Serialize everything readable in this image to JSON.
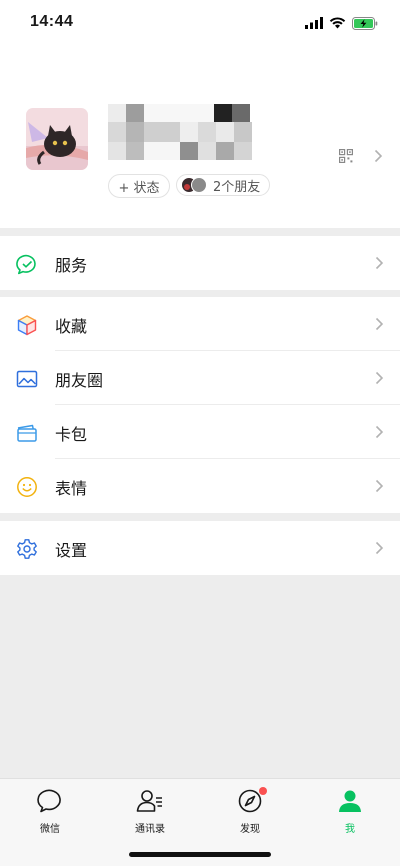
{
  "status_bar": {
    "time": "14:44"
  },
  "profile": {
    "status_chip": "+ 状态",
    "friends_chip": "2个朋友"
  },
  "menu": {
    "services": "服务",
    "favorites": "收藏",
    "moments": "朋友圈",
    "cards": "卡包",
    "stickers": "表情",
    "settings": "设置"
  },
  "tabs": [
    {
      "label": "微信"
    },
    {
      "label": "通讯录"
    },
    {
      "label": "发现"
    },
    {
      "label": "我"
    }
  ],
  "colors": {
    "accent": "#07c160",
    "badge": "#fa5151",
    "background": "#ededed"
  }
}
